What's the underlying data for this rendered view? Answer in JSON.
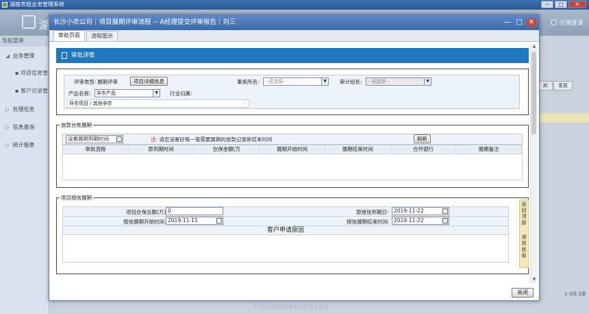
{
  "os_window": {
    "title": "湖南农担业务管理系统",
    "min": "─",
    "max": "□",
    "close": "✕"
  },
  "app_header": {
    "logo_text": "湖",
    "logout": "注销登录"
  },
  "sidebar": {
    "header": "导航菜单",
    "items": [
      {
        "label": "业务管理",
        "arrow": "◢"
      },
      {
        "label": "项目信息管",
        "sub": true
      },
      {
        "label": "客户记录管",
        "sub": true
      },
      {
        "label": "处理任务",
        "arrow": "▷"
      },
      {
        "label": "信息查询",
        "arrow": "▷"
      },
      {
        "label": "统计报表",
        "arrow": "▷"
      }
    ]
  },
  "background": {
    "btn_a": "刷",
    "btn_b": "重置",
    "pager": "1-3共 3条",
    "footer": "© 长沙佳翔科技有限公司 技术支持"
  },
  "dialog": {
    "title": "长沙小农公司｜项目展期评审流程 -- A经理提交评审报告｜刘三",
    "title_min": "—",
    "title_max": "□",
    "title_close": "✕",
    "tabs": [
      {
        "label": "审批页面",
        "active": true
      },
      {
        "label": "流程图示",
        "active": false
      }
    ],
    "section_title": "审批详情",
    "review": {
      "type_label": "评审类型:",
      "type_value": "展期评审",
      "detail_button": "项目详细信息",
      "office_label": "事务所名:",
      "office_value": "--请选择--",
      "group_label": "审计组长:",
      "group_value": "--请选择--",
      "product_label": "产品名称:",
      "product_value": "非农产品",
      "industry_label": "行业归属:",
      "industry_value": "非农项目 / 其他非农"
    },
    "ledger": {
      "legend": "放款台账展期",
      "set_date_placeholder": "设置展期到期时间",
      "note_prefix": "注:",
      "note_text": "请您设置好每一笔需要展期的放款记录新结束时间",
      "refresh_button": "刷新",
      "columns": [
        "审批流程",
        "原到期时间",
        "在保金额(万",
        "展期开始时间",
        "展期结束时间",
        "合作银行",
        "展期备注"
      ]
    },
    "credit": {
      "legend": "项目授信展期",
      "amount_label": "项目在保总额(万):",
      "amount_value": "0",
      "orig_due_label": "原授信到期日:",
      "orig_due_value": "2019-11-22",
      "start_label": "授信展期开始时间:",
      "start_value": "2019-11-15",
      "end_label": "授信展期结束时间:",
      "end_value": "2019-11-22",
      "reason_title": "客户申请原因"
    },
    "float_nav": {
      "top": "返回顶部",
      "bottom": "滑到底部"
    },
    "close_button": "关闭"
  }
}
